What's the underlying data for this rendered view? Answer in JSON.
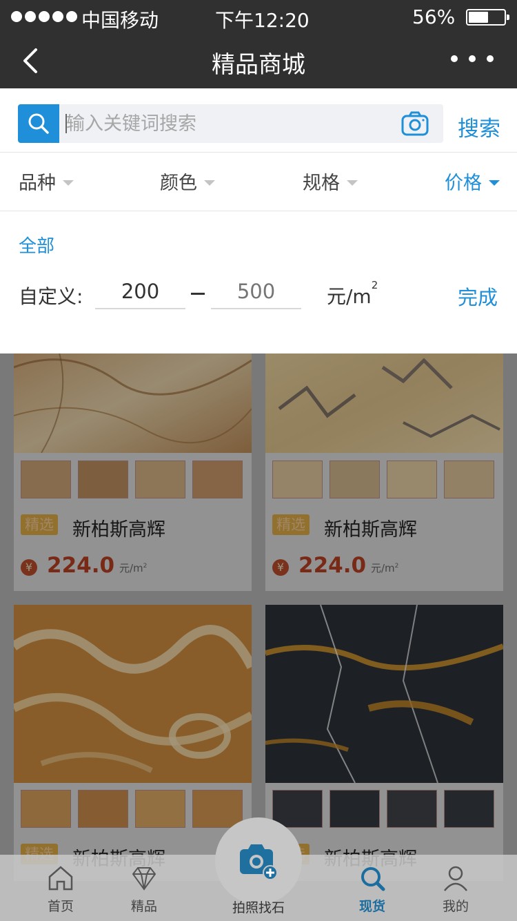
{
  "status_bar": {
    "carrier": "中国移动",
    "time": "下午12:20",
    "battery_percent": "56%",
    "battery_level": 0.56
  },
  "nav": {
    "title": "精品商城"
  },
  "search": {
    "placeholder": "输入关键词搜索",
    "button_label": "搜索"
  },
  "filters": [
    {
      "label": "品种",
      "active": false
    },
    {
      "label": "颜色",
      "active": false
    },
    {
      "label": "规格",
      "active": false
    },
    {
      "label": "价格",
      "active": true
    }
  ],
  "price_panel": {
    "all_label": "全部",
    "custom_label": "自定义:",
    "min_value": "200",
    "max_placeholder": "500",
    "unit": "元/m",
    "unit_sup": "2",
    "done_label": "完成"
  },
  "products": [
    {
      "tag": "精选",
      "name": "新柏斯高辉",
      "price": "224.0",
      "unit": "元/m",
      "unit_sup": "2",
      "yen": "¥"
    },
    {
      "tag": "精选",
      "name": "新柏斯高辉",
      "price": "224.0",
      "unit": "元/m",
      "unit_sup": "2",
      "yen": "¥"
    },
    {
      "tag": "精选",
      "name": "新柏斯高辉"
    },
    {
      "tag": "精选",
      "name": "新柏斯高辉"
    }
  ],
  "tabbar": {
    "items": [
      {
        "label": "首页",
        "icon": "home-icon"
      },
      {
        "label": "精品",
        "icon": "diamond-icon"
      },
      {
        "label": "拍照找石",
        "icon": "camera-icon"
      },
      {
        "label": "现货",
        "icon": "search-icon",
        "active": true
      },
      {
        "label": "我的",
        "icon": "user-icon"
      }
    ]
  },
  "colors": {
    "accent": "#1e8fd8",
    "nav_bg": "#303030",
    "price": "#b33f23",
    "tag": "#d8a545"
  }
}
